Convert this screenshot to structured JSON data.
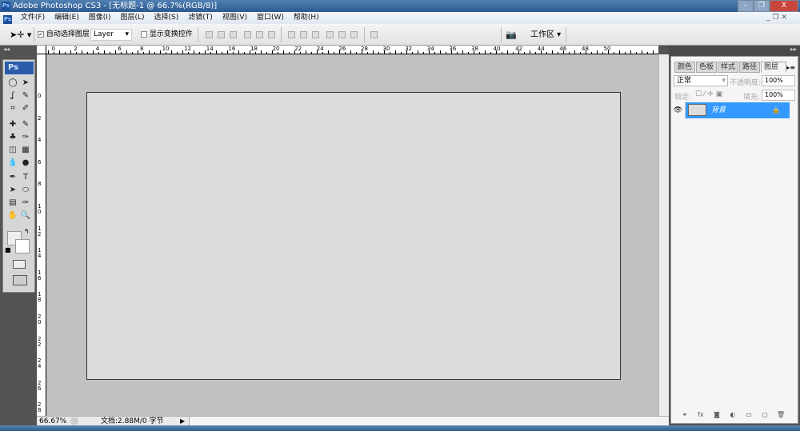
{
  "titlebar": {
    "title": "Adobe Photoshop CS3 - [无标题-1 @ 66.7%(RGB/8)]",
    "minimize": "–",
    "restore": "❐",
    "close": "X"
  },
  "menu": [
    "文件(F)",
    "编辑(E)",
    "图像(I)",
    "图层(L)",
    "选择(S)",
    "滤镜(T)",
    "视图(V)",
    "窗口(W)",
    "帮助(H)"
  ],
  "options": {
    "auto_select_label": "自动选择图层",
    "auto_select_checked": true,
    "layer_select": "Layer",
    "show_transform_label": "显示变换控件",
    "workspace": "工作区 ▾"
  },
  "ruler": {
    "top": [
      "2",
      "0",
      "2",
      "4",
      "6",
      "8",
      "10",
      "12",
      "14",
      "16",
      "18",
      "20",
      "22",
      "24",
      "26",
      "28",
      "30",
      "32",
      "34",
      "36",
      "38",
      "40",
      "42",
      "44",
      "46",
      "48",
      "50"
    ],
    "left": [
      "0",
      "2",
      "4",
      "6",
      "8",
      "10",
      "12",
      "14",
      "16",
      "18",
      "20",
      "22",
      "24",
      "26",
      "28"
    ]
  },
  "toolbox": {
    "logo": "Ps"
  },
  "status": {
    "zoom": "66.67%",
    "doc_info": "文档:2.88M/0 字节"
  },
  "panel": {
    "collapse": "▸▸",
    "tabs": [
      "颜色",
      "色板",
      "样式",
      "路径",
      "图层"
    ],
    "active_tab": "图层",
    "blend_mode": "正常",
    "opacity_label": "不透明度:",
    "opacity": "100%",
    "lock_label": "锁定:",
    "fill_label": "填充:",
    "fill": "100%",
    "layers": [
      {
        "name": "背景",
        "visible": true,
        "locked": true,
        "selected": true
      }
    ]
  },
  "colors": {
    "accent": "#3399ff",
    "canvas": "#dcdcdc",
    "workspace": "#c1c1c1"
  }
}
